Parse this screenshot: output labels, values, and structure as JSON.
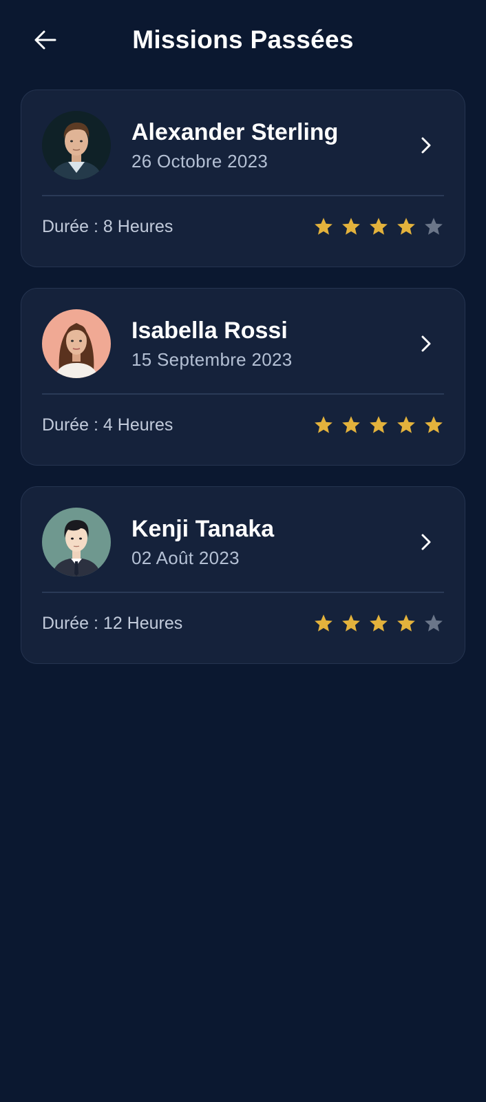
{
  "header": {
    "title": "Missions Passées",
    "back_icon": "arrow-left-icon"
  },
  "colors": {
    "background": "#0b1830",
    "card": "#15223b",
    "star_filled": "#e3b23c",
    "star_empty": "#6b7689"
  },
  "missions": [
    {
      "name": "Alexander Sterling",
      "date": "26 Octobre 2023",
      "duration": "Durée : 8 Heures",
      "rating": 4,
      "rating_max": 5,
      "avatar_bg": "#0f2127"
    },
    {
      "name": "Isabella Rossi",
      "date": "15 Septembre 2023",
      "duration": "Durée : 4 Heures",
      "rating": 5,
      "rating_max": 5,
      "avatar_bg": "#f0a994"
    },
    {
      "name": "Kenji Tanaka",
      "date": "02 Août 2023",
      "duration": "Durée : 12 Heures",
      "rating": 4,
      "rating_max": 5,
      "avatar_bg": "#6f988f"
    }
  ]
}
